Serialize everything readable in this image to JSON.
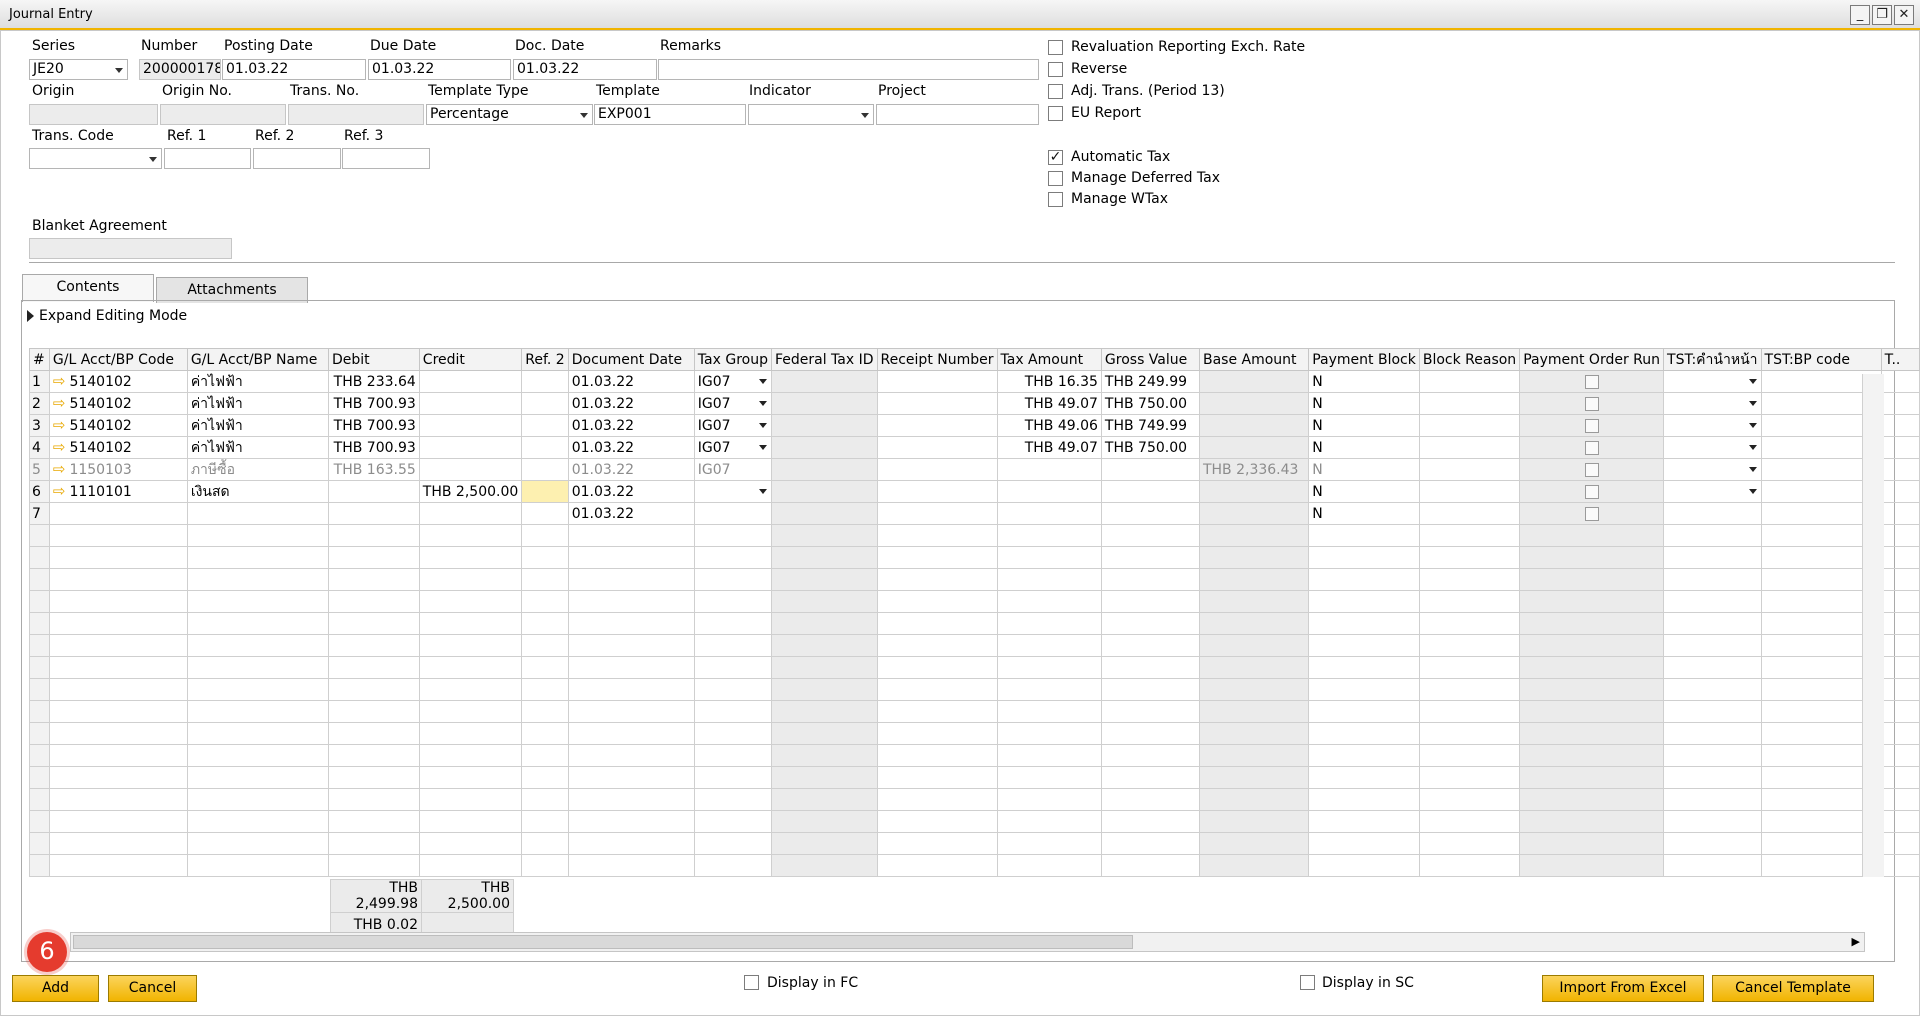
{
  "window": {
    "title": "Journal Entry",
    "controls": {
      "minimize": "_",
      "restore": "❐",
      "close": "✕"
    }
  },
  "header": {
    "series": {
      "label": "Series",
      "value": "JE20"
    },
    "number": {
      "label": "Number",
      "value": "200000178"
    },
    "posting_date": {
      "label": "Posting Date",
      "value": "01.03.22"
    },
    "due_date": {
      "label": "Due Date",
      "value": "01.03.22"
    },
    "doc_date": {
      "label": "Doc. Date",
      "value": "01.03.22"
    },
    "remarks": {
      "label": "Remarks",
      "value": ""
    },
    "origin": {
      "label": "Origin",
      "value": ""
    },
    "origin_no": {
      "label": "Origin No.",
      "value": ""
    },
    "trans_no": {
      "label": "Trans. No.",
      "value": ""
    },
    "template_type": {
      "label": "Template Type",
      "value": "Percentage"
    },
    "template": {
      "label": "Template",
      "value": "EXP001"
    },
    "indicator": {
      "label": "Indicator",
      "value": ""
    },
    "project": {
      "label": "Project",
      "value": ""
    },
    "trans_code": {
      "label": "Trans. Code",
      "value": ""
    },
    "ref1": {
      "label": "Ref. 1",
      "value": ""
    },
    "ref2": {
      "label": "Ref. 2",
      "value": ""
    },
    "ref3": {
      "label": "Ref. 3",
      "value": ""
    },
    "blanket_agreement": {
      "label": "Blanket Agreement",
      "value": ""
    }
  },
  "options": [
    {
      "label": "Revaluation Reporting Exch. Rate",
      "checked": false
    },
    {
      "label": "Reverse",
      "checked": false
    },
    {
      "label": "Adj. Trans. (Period 13)",
      "checked": false
    },
    {
      "label": "EU Report",
      "checked": false
    },
    {
      "label": "Automatic Tax",
      "checked": true
    },
    {
      "label": "Manage Deferred Tax",
      "checked": false
    },
    {
      "label": "Manage WTax",
      "checked": false
    }
  ],
  "tabs": [
    "Contents",
    "Attachments"
  ],
  "expand_editing_mode": "Expand Editing Mode",
  "grid": {
    "columns": [
      "#",
      "G/L Acct/BP Code",
      "G/L Acct/BP Name",
      "Debit",
      "Credit",
      "Ref. 2",
      "Document Date",
      "Tax Group",
      "Federal Tax ID",
      "Receipt Number",
      "Tax Amount",
      "Gross Value",
      "Base Amount",
      "Payment Block",
      "Block Reason",
      "Payment Order Run",
      "TST:คำนำหน้า",
      "TST:BP code",
      "T.."
    ],
    "rows": [
      {
        "num": "1",
        "code": "5140102",
        "name": "ค่าไฟฟ้า",
        "debit": "THB 233.64",
        "credit": "",
        "ref2": "",
        "doc_date": "01.03.22",
        "tax_group": "IG07",
        "tax_amount": "THB 16.35",
        "gross": "THB 249.99",
        "base": "",
        "pay_block": "N"
      },
      {
        "num": "2",
        "code": "5140102",
        "name": "ค่าไฟฟ้า",
        "debit": "THB 700.93",
        "credit": "",
        "ref2": "",
        "doc_date": "01.03.22",
        "tax_group": "IG07",
        "tax_amount": "THB 49.07",
        "gross": "THB 750.00",
        "base": "",
        "pay_block": "N"
      },
      {
        "num": "3",
        "code": "5140102",
        "name": "ค่าไฟฟ้า",
        "debit": "THB 700.93",
        "credit": "",
        "ref2": "",
        "doc_date": "01.03.22",
        "tax_group": "IG07",
        "tax_amount": "THB 49.06",
        "gross": "THB 749.99",
        "base": "",
        "pay_block": "N"
      },
      {
        "num": "4",
        "code": "5140102",
        "name": "ค่าไฟฟ้า",
        "debit": "THB 700.93",
        "credit": "",
        "ref2": "",
        "doc_date": "01.03.22",
        "tax_group": "IG07",
        "tax_amount": "THB 49.07",
        "gross": "THB 750.00",
        "base": "",
        "pay_block": "N"
      },
      {
        "num": "5",
        "code": "1150103",
        "name": "ภาษีซื้อ",
        "debit": "THB 163.55",
        "credit": "",
        "ref2": "",
        "doc_date": "01.03.22",
        "tax_group": "IG07",
        "tax_amount": "",
        "gross": "",
        "base": "THB 2,336.43",
        "pay_block": "N"
      },
      {
        "num": "6",
        "code": "1110101",
        "name": "เงินสด",
        "debit": "",
        "credit": "THB 2,500.00",
        "ref2": "",
        "doc_date": "01.03.22",
        "tax_group": "",
        "tax_amount": "",
        "gross": "",
        "base": "",
        "pay_block": "N"
      },
      {
        "num": "7",
        "code": "",
        "name": "",
        "debit": "",
        "credit": "",
        "ref2": "",
        "doc_date": "01.03.22",
        "tax_group": "",
        "tax_amount": "",
        "gross": "",
        "base": "",
        "pay_block": "N"
      }
    ]
  },
  "totals": {
    "debit_total": "THB 2,499.98",
    "credit_total": "THB 2,500.00",
    "difference": "THB 0.02"
  },
  "footer": {
    "add": "Add",
    "cancel": "Cancel",
    "display_fc": "Display in FC",
    "display_sc": "Display in SC",
    "import_excel": "Import From Excel",
    "cancel_template": "Cancel Template",
    "step_badge": "6"
  },
  "colors": {
    "accent": "#f1b400",
    "badge": "#e53b2e",
    "readonly": "#ebebeb"
  }
}
